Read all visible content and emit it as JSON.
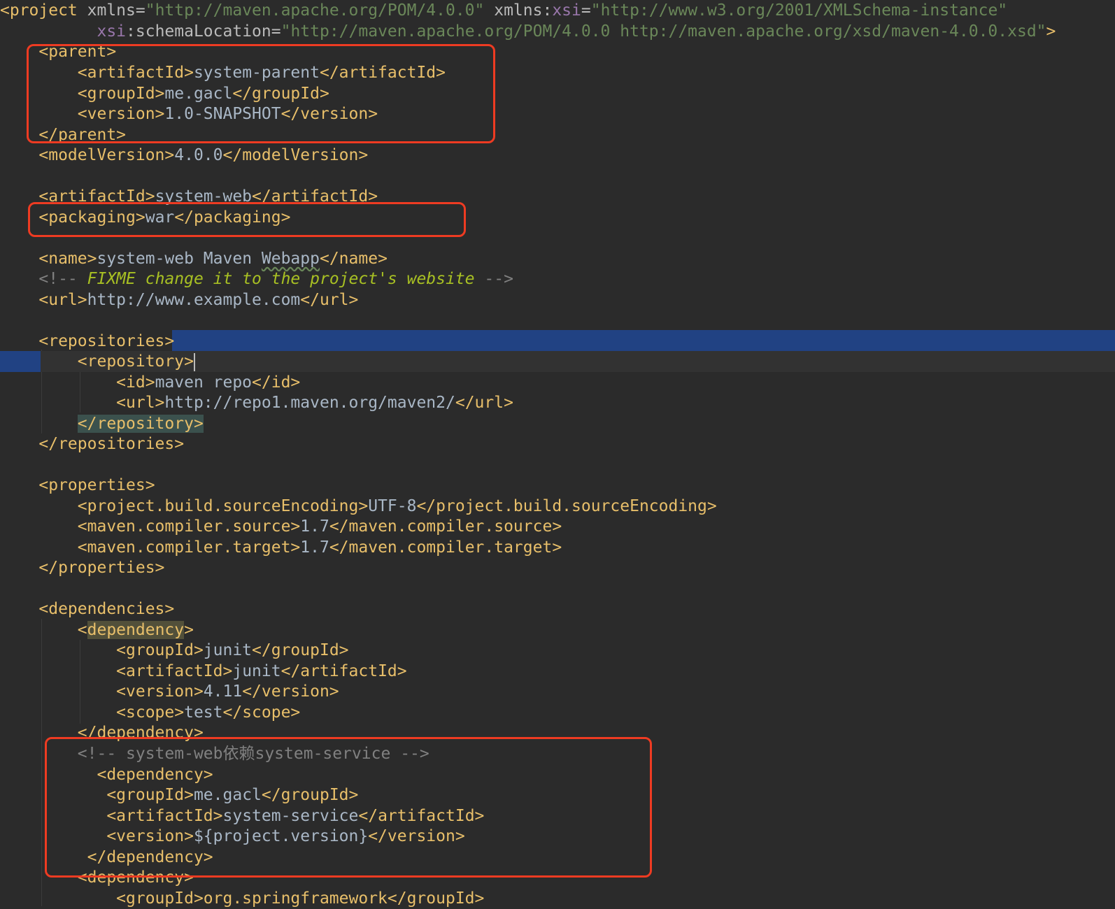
{
  "colors": {
    "background": "#2b2b2b",
    "tag": "#e8bf6a",
    "text": "#a9b7c6",
    "string": "#6a8759",
    "namespace": "#9876aa",
    "comment": "#808080",
    "todo": "#a8c023",
    "selection": "#214283",
    "annotation": "#ee3b22"
  },
  "code": {
    "l01": {
      "a": "<project",
      "b": " xmlns=",
      "c": "\"http://maven.apache.org/POM/4.0.0\"",
      "d": " xmlns:",
      "e": "xsi",
      "f": "=",
      "g": "\"http://www.w3.org/2001/XMLSchema-instance\""
    },
    "l02": {
      "a": "xsi",
      "b": ":schemaLocation=",
      "c": "\"http://maven.apache.org/POM/4.0.0 http://maven.apache.org/xsd/maven-4.0.0.xsd\"",
      "d": ">"
    },
    "l03": "<parent>",
    "l04": {
      "o": "<artifactId>",
      "v": "system-parent",
      "c": "</artifactId>"
    },
    "l05": {
      "o": "<groupId>",
      "v": "me.gacl",
      "c": "</groupId>"
    },
    "l06": {
      "o": "<version>",
      "v": "1.0-SNAPSHOT",
      "c": "</version>"
    },
    "l07": "</parent>",
    "l08": {
      "o": "<modelVersion>",
      "v": "4.0.0",
      "c": "</modelVersion>"
    },
    "l10": {
      "o": "<artifactId>",
      "v": "system-web",
      "c": "</artifactId>"
    },
    "l11": {
      "o": "<packaging>",
      "v": "war",
      "c": "</packaging>"
    },
    "l13": {
      "o": "<name>",
      "v1": "system-web Maven ",
      "v2": "Webapp",
      "c": "</name>"
    },
    "l14": {
      "open": "<!-- ",
      "text": "FIXME change it to the project's website",
      "close": " -->"
    },
    "l15": {
      "o": "<url>",
      "v": "http://www.example.com",
      "c": "</url>"
    },
    "l17": "<repositories>",
    "l18": "<repository>",
    "l19": {
      "o": "<id>",
      "v": "maven repo",
      "c": "</id>"
    },
    "l20": {
      "o": "<url>",
      "v": "http://repo1.maven.org/maven2/",
      "c": "</url>"
    },
    "l21": "</repository>",
    "l22": "</repositories>",
    "l24": "<properties>",
    "l25": {
      "o": "<project.build.sourceEncoding>",
      "v": "UTF-8",
      "c": "</project.build.sourceEncoding>"
    },
    "l26": {
      "o": "<maven.compiler.source>",
      "v": "1.7",
      "c": "</maven.compiler.source>"
    },
    "l27": {
      "o": "<maven.compiler.target>",
      "v": "1.7",
      "c": "</maven.compiler.target>"
    },
    "l28": "</properties>",
    "l30": "<dependencies>",
    "l31": {
      "lt": "<",
      "name": "dependency",
      "gt": ">"
    },
    "l32": {
      "o": "<groupId>",
      "v": "junit",
      "c": "</groupId>"
    },
    "l33": {
      "o": "<artifactId>",
      "v": "junit",
      "c": "</artifactId>"
    },
    "l34": {
      "o": "<version>",
      "v": "4.11",
      "c": "</version>"
    },
    "l35": {
      "o": "<scope>",
      "v": "test",
      "c": "</scope>"
    },
    "l36": "</dependency>",
    "l37": "<!-- system-web依赖system-service -->",
    "l38": "<dependency>",
    "l39": {
      "o": "<groupId>",
      "v": "me.gacl",
      "c": "</groupId>"
    },
    "l40": {
      "o": "<artifactId>",
      "v": "system-service",
      "c": "</artifactId>"
    },
    "l41": {
      "o": "<version>",
      "v": "${project.version}",
      "c": "</version>"
    },
    "l42": "</dependency>",
    "l43": "<dependency>",
    "l44": "<groupId>org.springframework</groupId>"
  }
}
